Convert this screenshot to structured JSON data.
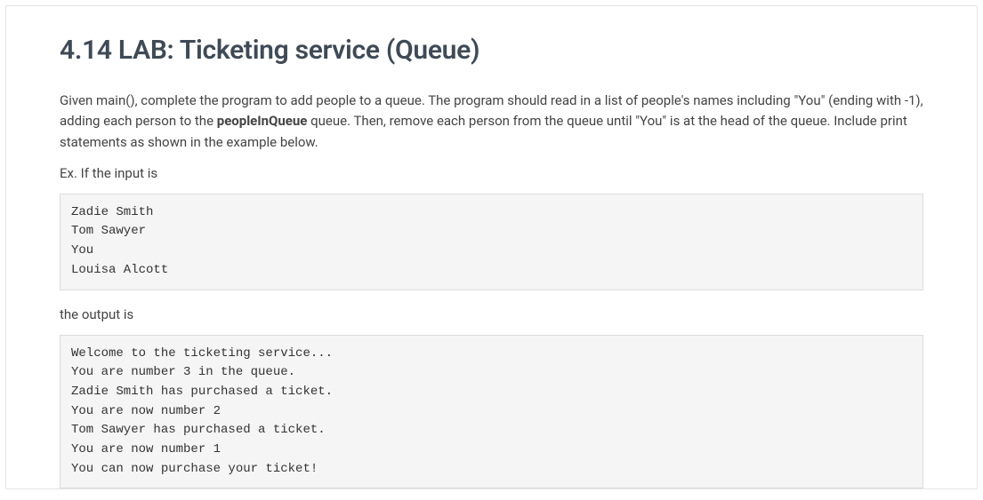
{
  "title": "4.14 LAB: Ticketing service (Queue)",
  "description": {
    "part1": "Given main(), complete the program to add people to a queue. The program should read in a list of people's names including \"You\" (ending with -1), adding each person to the ",
    "bold": "peopleInQueue",
    "part2": " queue. Then, remove each person from the queue until \"You\" is at the head of the queue. Include print statements as shown in the example below."
  },
  "exampleIntro": "Ex. If the input is",
  "inputCode": "Zadie Smith\nTom Sawyer\nYou\nLouisa Alcott",
  "outputIntro": "the output is",
  "outputCode": "Welcome to the ticketing service... \nYou are number 3 in the queue.\nZadie Smith has purchased a ticket.\nYou are now number 2\nTom Sawyer has purchased a ticket.\nYou are now number 1\nYou can now purchase your ticket!"
}
